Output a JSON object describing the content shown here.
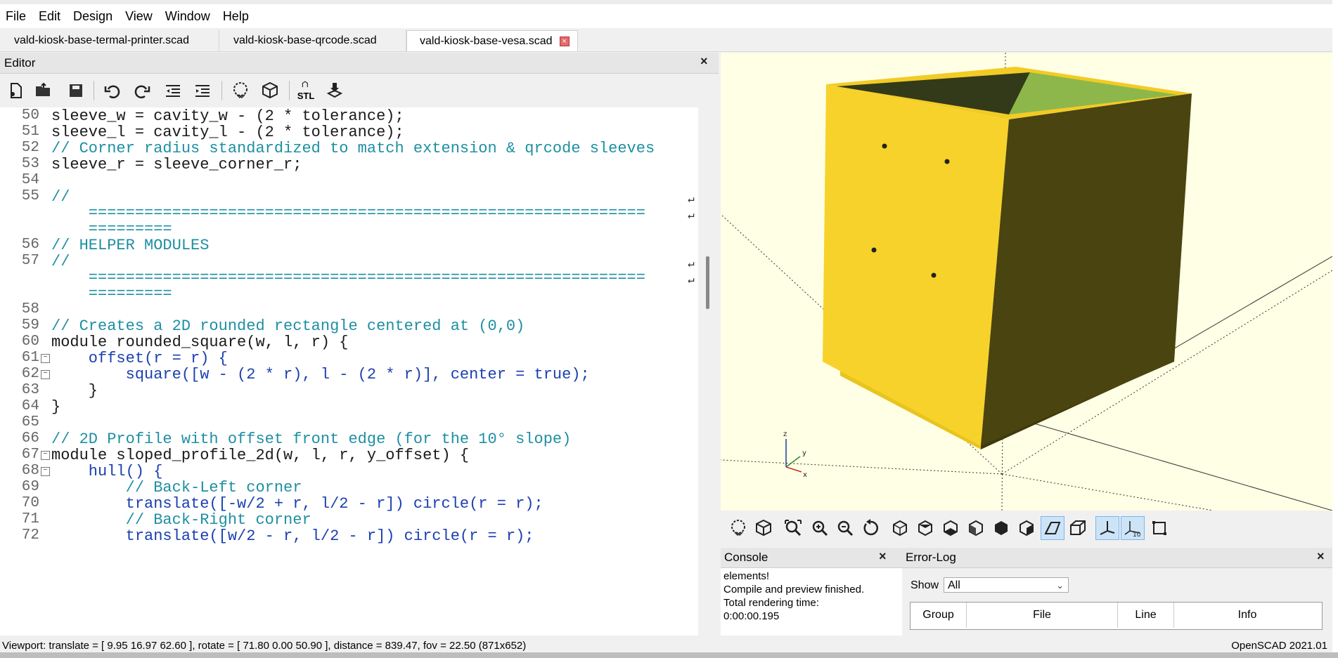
{
  "menu": [
    "File",
    "Edit",
    "Design",
    "View",
    "Window",
    "Help"
  ],
  "tabs": [
    {
      "label": "vald-kiosk-base-termal-printer.scad",
      "active": false
    },
    {
      "label": "vald-kiosk-base-qrcode.scad",
      "active": false
    },
    {
      "label": "vald-kiosk-base-vesa.scad",
      "active": true
    }
  ],
  "editor": {
    "title": "Editor",
    "close": "×",
    "toolbar_icons": [
      "new-file-icon",
      "open-file-icon",
      "save-icon",
      "undo-icon",
      "redo-icon",
      "unindent-icon",
      "indent-icon",
      "preview-icon",
      "render-icon",
      "export-stl-icon",
      "send-to-print-icon"
    ],
    "stl_label": "STL",
    "lines": [
      {
        "n": "50",
        "text": "sleeve_w = cavity_w - (2 * tolerance);"
      },
      {
        "n": "51",
        "text": "sleeve_l = cavity_l - (2 * tolerance);"
      },
      {
        "n": "52",
        "text": "// Corner radius standardized to match extension & qrcode sleeves"
      },
      {
        "n": "53",
        "text": "sleeve_r = sleeve_corner_r;"
      },
      {
        "n": "54",
        "text": ""
      },
      {
        "n": "55",
        "text": "//"
      },
      {
        "n": "",
        "text": "    ============================================================"
      },
      {
        "n": "",
        "text": "    ========="
      },
      {
        "n": "56",
        "text": "// HELPER MODULES"
      },
      {
        "n": "57",
        "text": "//"
      },
      {
        "n": "",
        "text": "    ============================================================"
      },
      {
        "n": "",
        "text": "    ========="
      },
      {
        "n": "58",
        "text": ""
      },
      {
        "n": "59",
        "text": "// Creates a 2D rounded rectangle centered at (0,0)"
      },
      {
        "n": "60",
        "text": "module rounded_square(w, l, r) {"
      },
      {
        "n": "61",
        "text": "    offset(r = r) {"
      },
      {
        "n": "62",
        "text": "        square([w - (2 * r), l - (2 * r)], center = true);"
      },
      {
        "n": "63",
        "text": "    }"
      },
      {
        "n": "64",
        "text": "}"
      },
      {
        "n": "65",
        "text": ""
      },
      {
        "n": "66",
        "text": "// 2D Profile with offset front edge (for the 10° slope)"
      },
      {
        "n": "67",
        "text": "module sloped_profile_2d(w, l, r, y_offset) {"
      },
      {
        "n": "68",
        "text": "    hull() {"
      },
      {
        "n": "69",
        "text": "        // Back-Left corner"
      },
      {
        "n": "70",
        "text": "        translate([-w/2 + r, l/2 - r]) circle(r = r);"
      },
      {
        "n": "71",
        "text": "        // Back-Right corner"
      },
      {
        "n": "72",
        "text": "        translate([w/2 - r, l/2 - r]) circle(r = r);"
      }
    ]
  },
  "viewport_toolbar_icons": [
    "preview-icon",
    "render-icon",
    "view-all-icon",
    "zoom-in-icon",
    "zoom-out-icon",
    "reset-view-icon",
    "view-right-icon",
    "view-top-icon",
    "view-bottom-icon",
    "view-left-icon",
    "view-front-icon",
    "view-back-icon",
    "perspective-icon",
    "orthogonal-icon",
    "show-axes-icon",
    "show-scale-markers-icon",
    "show-edges-icon"
  ],
  "scale_label": "10",
  "axis_labels": {
    "x": "x",
    "y": "y",
    "z": "z"
  },
  "console": {
    "title": "Console",
    "close": "×",
    "lines": [
      "elements!",
      "Compile and preview finished.",
      "Total rendering time:",
      "0:00:00.195"
    ]
  },
  "errorlog": {
    "title": "Error-Log",
    "close": "×",
    "show_label": "Show",
    "show_value": "All",
    "columns": [
      "Group",
      "File",
      "Line",
      "Info"
    ]
  },
  "status": {
    "viewport": "Viewport: translate = [ 9.95 16.97 62.60 ], rotate = [ 71.80 0.00 50.90 ], distance = 839.47, fov = 22.50 (871x652)",
    "version": "OpenSCAD 2021.01"
  },
  "colors": {
    "model": "#f7d22a",
    "model_shadow": "#4a4410",
    "viewport_bg": "#ffffe5",
    "inner_green": "#8db74a"
  }
}
